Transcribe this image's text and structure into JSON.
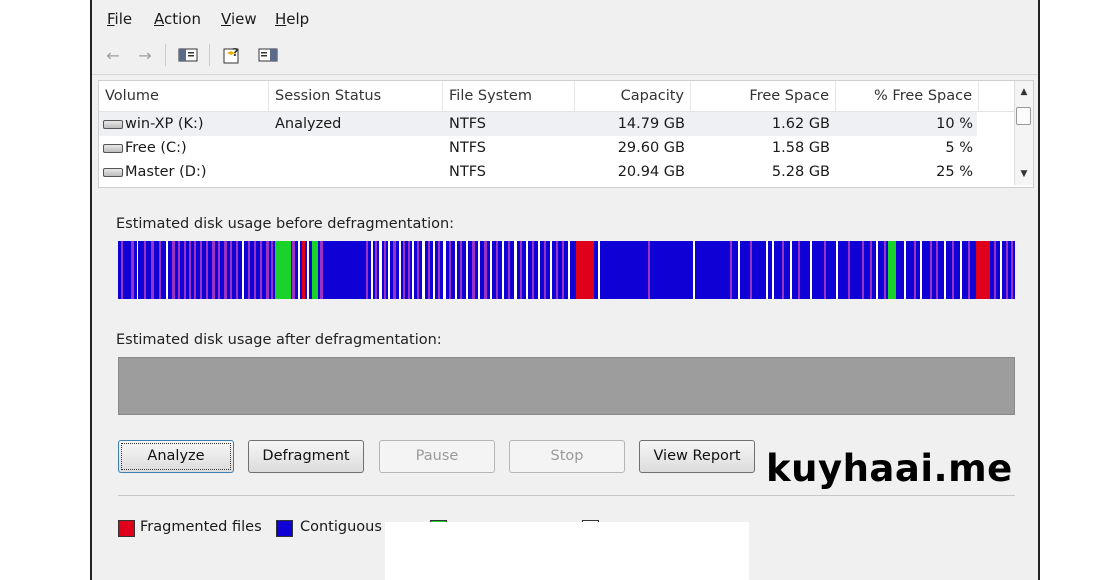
{
  "menu": [
    "File",
    "Action",
    "View",
    "Help"
  ],
  "toolbar": {
    "buttons": [
      "back-arrow-icon",
      "forward-arrow-icon",
      "show-hide-console-tree-icon",
      "help-icon",
      "show-hide-action-pane-icon"
    ]
  },
  "volumes": {
    "columns": [
      "Volume",
      "Session Status",
      "File System",
      "Capacity",
      "Free Space",
      "% Free Space"
    ],
    "rows": [
      {
        "volume": "win-XP (K:)",
        "status": "Analyzed",
        "fs": "NTFS",
        "capacity": "14.79 GB",
        "free": "1.62 GB",
        "pct": "10 %"
      },
      {
        "volume": "Free (C:)",
        "status": "",
        "fs": "NTFS",
        "capacity": "29.60 GB",
        "free": "1.58 GB",
        "pct": "5 %"
      },
      {
        "volume": "Master (D:)",
        "status": "",
        "fs": "NTFS",
        "capacity": "20.94 GB",
        "free": "5.28 GB",
        "pct": "25 %"
      }
    ],
    "selected_row": 0
  },
  "before_label": "Estimated disk usage before defragmentation:",
  "after_label": "Estimated disk usage after defragmentation:",
  "colors": {
    "fragmented": "#e0001b",
    "contiguous": "#0f00d6",
    "unmovable": "#19d22a",
    "free": "#ffffff",
    "stripe_purple": "#9b32c8",
    "stripe_white": "#ffffff",
    "after_gray": "#9d9d9d"
  },
  "buttons": {
    "analyze": "Analyze",
    "defragment": "Defragment",
    "pause": "Pause",
    "stop": "Stop",
    "view_report": "View Report"
  },
  "legend": {
    "fragmented": "Fragmented files",
    "contiguous": "Contiguous"
  },
  "watermark": "kuyhaai.me"
}
